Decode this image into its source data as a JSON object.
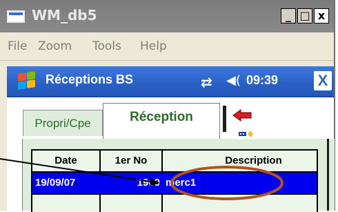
{
  "window": {
    "title": "WM_db5",
    "buttons": {
      "minimize": "_",
      "maximize": "□",
      "close": "x"
    }
  },
  "menu": [
    "File",
    "Zoom",
    "Tools",
    "Help"
  ],
  "device": {
    "taskbar": {
      "app_title": "Réceptions BS",
      "time": "09:39",
      "close_label": "X"
    },
    "tabs": [
      {
        "label": "Propri/Cpe",
        "selected": false
      },
      {
        "label": "Réception",
        "selected": true
      }
    ],
    "table": {
      "headers": [
        "Date",
        "1er No",
        "Description"
      ],
      "rows": [
        {
          "date": "19/09/07",
          "number": "1900",
          "description": "merc1",
          "selected": true
        }
      ]
    }
  },
  "colors": {
    "taskbar": "#2a5fc6",
    "selected_row": "#0000ee",
    "tab_text": "#2c6b2a",
    "annotation_ellipse": "#b0531f"
  },
  "icons": [
    "window-app-icon",
    "windows-start-icon",
    "network-sync-icon",
    "volume-icon",
    "red-back-arrow-icon",
    "toolbar-glyph-icon"
  ]
}
